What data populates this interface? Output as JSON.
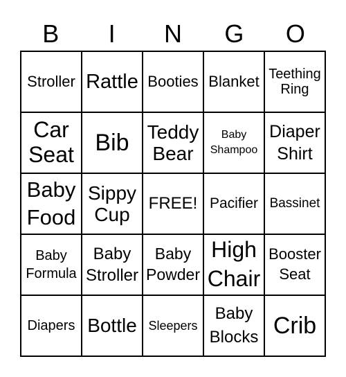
{
  "header": [
    "B",
    "I",
    "N",
    "G",
    "O"
  ],
  "cells": [
    "Stroller",
    "Rattle",
    "Booties",
    "Blanket",
    "Teething\nRing",
    "Car\nSeat",
    "Bib",
    "Teddy\nBear",
    "Baby\nShampoo",
    "Diaper\nShirt",
    "Baby\nFood",
    "Sippy\nCup",
    "FREE!",
    "Pacifier",
    "Bassinet",
    "Baby\nFormula",
    "Baby\nStroller",
    "Baby\nPowder",
    "High\nChair",
    "Booster\nSeat",
    "Diapers",
    "Bottle",
    "Sleepers",
    "Baby\nBlocks",
    "Crib"
  ]
}
